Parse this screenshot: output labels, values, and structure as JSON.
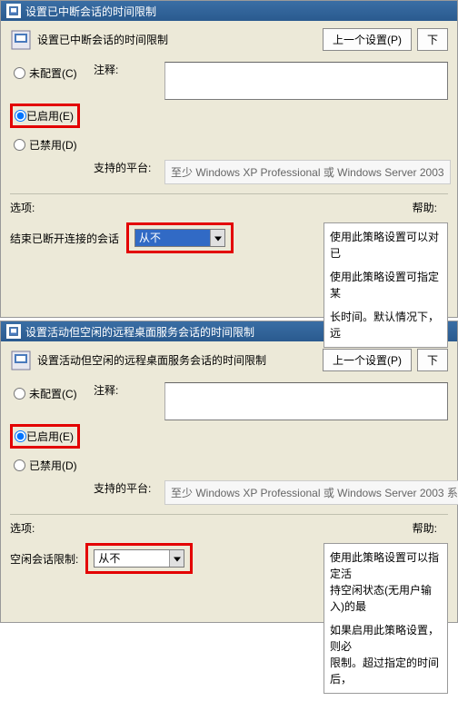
{
  "window1": {
    "title": "设置已中断会话的时间限制",
    "header": "设置已中断会话的时间限制",
    "prev_btn": "上一个设置(P)",
    "next_btn": "下",
    "radio_unconfigured": "未配置(C)",
    "radio_enabled": "已启用(E)",
    "radio_disabled": "已禁用(D)",
    "comment_label": "注释:",
    "comment_value": "",
    "platform_label": "支持的平台:",
    "platform_value": "至少 Windows XP Professional 或 Windows Server 2003",
    "options_label": "选项:",
    "help_label": "帮助:",
    "dd_label": "结束已断开连接的会话",
    "dd_value": "从不",
    "help_line1": "使用此策略设置可以对已",
    "help_line2": "使用此策略设置可指定某",
    "help_line3": "长时间。默认情况下，远"
  },
  "window2": {
    "title": "设置活动但空闲的远程桌面服务会话的时间限制",
    "header": "设置活动但空闲的远程桌面服务会话的时间限制",
    "prev_btn": "上一个设置(P)",
    "next_btn": "下",
    "radio_unconfigured": "未配置(C)",
    "radio_enabled": "已启用(E)",
    "radio_disabled": "已禁用(D)",
    "comment_label": "注释:",
    "comment_value": "",
    "platform_label": "支持的平台:",
    "platform_value": "至少 Windows XP Professional 或 Windows Server 2003 系",
    "options_label": "选项:",
    "help_label": "帮助:",
    "dd_label": "空闲会话限制:",
    "dd_value": "从不",
    "help_line1": "使用此策略设置可以指定活",
    "help_line2": "持空闲状态(无用户输入)的最",
    "help_line3": "如果启用此策略设置，则必",
    "help_line4": "限制。超过指定的时间后，"
  }
}
